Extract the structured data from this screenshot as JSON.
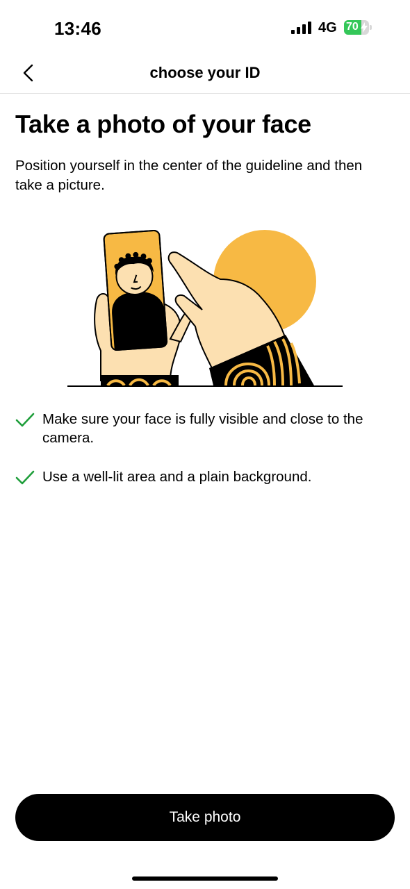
{
  "status_bar": {
    "time": "13:46",
    "network": "4G",
    "battery_percent": "70",
    "battery_level": 0.7,
    "battery_color": "#34c759",
    "signal_icon": "cellular-signal-icon",
    "charging_icon": "bolt-icon"
  },
  "nav": {
    "back_icon": "chevron-left-icon",
    "title": "choose your ID"
  },
  "content": {
    "title": "Take a photo of your face",
    "description": "Position yourself in the center of the guideline and then take a picture.",
    "illustration_accent": "#f7b944",
    "tips": [
      {
        "icon": "checkmark-icon",
        "text": "Make sure your face is fully visible and close to the camera."
      },
      {
        "icon": "checkmark-icon",
        "text": "Use a well-lit area and a plain background."
      }
    ],
    "check_color": "#1e9e3a"
  },
  "footer": {
    "button_label": "Take photo"
  }
}
